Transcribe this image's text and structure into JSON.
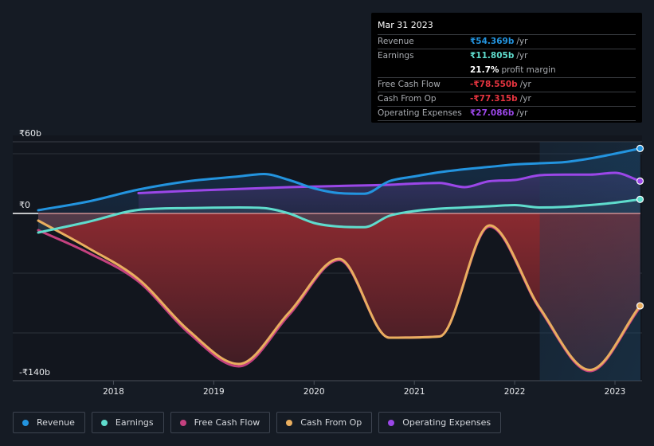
{
  "tooltip": {
    "date": "Mar 31 2023",
    "rows": [
      {
        "label": "Revenue",
        "value": "₹54.369b",
        "unit": "/yr",
        "color": "#2394df"
      },
      {
        "label": "Earnings",
        "value": "₹11.805b",
        "unit": "/yr",
        "color": "#5fdccd"
      },
      {
        "label": "",
        "value": "21.7%",
        "unit": "profit margin",
        "color": "#ffffff"
      },
      {
        "label": "Free Cash Flow",
        "value": "-₹78.550b",
        "unit": "/yr",
        "color": "#e5343f"
      },
      {
        "label": "Cash From Op",
        "value": "-₹77.315b",
        "unit": "/yr",
        "color": "#e5343f"
      },
      {
        "label": "Operating Expenses",
        "value": "₹27.086b",
        "unit": "/yr",
        "color": "#9b47e8"
      }
    ]
  },
  "legend": [
    {
      "label": "Revenue",
      "color": "#2394df"
    },
    {
      "label": "Earnings",
      "color": "#5fdccd"
    },
    {
      "label": "Free Cash Flow",
      "color": "#c4417f"
    },
    {
      "label": "Cash From Op",
      "color": "#e9ae5f"
    },
    {
      "label": "Operating Expenses",
      "color": "#9b47e8"
    }
  ],
  "chart_data": {
    "type": "area",
    "title": "",
    "xlabel": "",
    "ylabel": "",
    "currency": "₹",
    "ylim": [
      -140,
      60
    ],
    "xlim": [
      2017.25,
      2023.25
    ],
    "y_tick_labels": [
      "₹60b",
      "₹0",
      "-₹140b"
    ],
    "y_tick_values": [
      60,
      0,
      -140
    ],
    "gridlines_at": [
      50,
      0,
      -50,
      -100
    ],
    "x_tick_labels": [
      "2018",
      "2019",
      "2020",
      "2021",
      "2022",
      "2023"
    ],
    "x_tick_values": [
      2018,
      2019,
      2020,
      2021,
      2022,
      2023
    ],
    "highlight_from": 2022.25,
    "legend_position": "bottom",
    "series": [
      {
        "name": "Revenue",
        "color": "#2394df",
        "unit": "b",
        "x": [
          2017.25,
          2017.75,
          2018.25,
          2018.75,
          2019.25,
          2019.5,
          2019.75,
          2020.0,
          2020.25,
          2020.5,
          2020.75,
          2021.0,
          2021.25,
          2021.5,
          2021.75,
          2022.0,
          2022.25,
          2022.5,
          2022.75,
          2023.0,
          2023.25
        ],
        "values": [
          2.7,
          10,
          20,
          27,
          31,
          33,
          28,
          21,
          17,
          16.5,
          27,
          31,
          34.5,
          37,
          39,
          41,
          42,
          43,
          46,
          50,
          54.4
        ]
      },
      {
        "name": "Earnings",
        "color": "#5fdccd",
        "unit": "b",
        "x": [
          2017.25,
          2017.75,
          2018.25,
          2018.75,
          2019.25,
          2019.5,
          2019.75,
          2020.0,
          2020.25,
          2020.5,
          2020.75,
          2021.0,
          2021.25,
          2021.5,
          2021.75,
          2022.0,
          2022.25,
          2022.5,
          2022.75,
          2023.0,
          2023.25
        ],
        "values": [
          -16,
          -7,
          3,
          4.5,
          5,
          4.5,
          0,
          -8,
          -11,
          -11.5,
          -2,
          2,
          4,
          5,
          6,
          7,
          5,
          5.5,
          7,
          9,
          11.8
        ]
      },
      {
        "name": "Free Cash Flow",
        "color": "#c4417f",
        "unit": "b",
        "x": [
          2017.25,
          2017.75,
          2018.25,
          2018.75,
          2019.25,
          2019.75,
          2020.25,
          2020.75,
          2021.25,
          2021.75,
          2022.25,
          2022.75,
          2023.25
        ],
        "values": [
          -14,
          -33,
          -57,
          -100,
          -128,
          -85,
          -39,
          -104,
          -103,
          -11,
          -80,
          -132,
          -78.6
        ]
      },
      {
        "name": "Cash From Op",
        "color": "#e9ae5f",
        "unit": "b",
        "x": [
          2017.25,
          2017.75,
          2018.25,
          2018.75,
          2019.25,
          2019.75,
          2020.25,
          2020.75,
          2021.25,
          2021.75,
          2022.25,
          2022.75,
          2023.25
        ],
        "values": [
          -6,
          -29,
          -55,
          -98,
          -126,
          -83,
          -38,
          -104,
          -103,
          -10,
          -79,
          -131,
          -77.3
        ]
      },
      {
        "name": "Operating Expenses",
        "color": "#9b47e8",
        "unit": "b",
        "x": [
          2018.25,
          2018.75,
          2019.25,
          2019.75,
          2020.25,
          2020.75,
          2021.0,
          2021.25,
          2021.5,
          2021.75,
          2022.0,
          2022.25,
          2022.5,
          2022.75,
          2023.0,
          2023.25
        ],
        "values": [
          17,
          19,
          20.5,
          22,
          23,
          24,
          25,
          25.5,
          22,
          27,
          28,
          32,
          32.5,
          32.5,
          34,
          27.1
        ]
      }
    ]
  }
}
